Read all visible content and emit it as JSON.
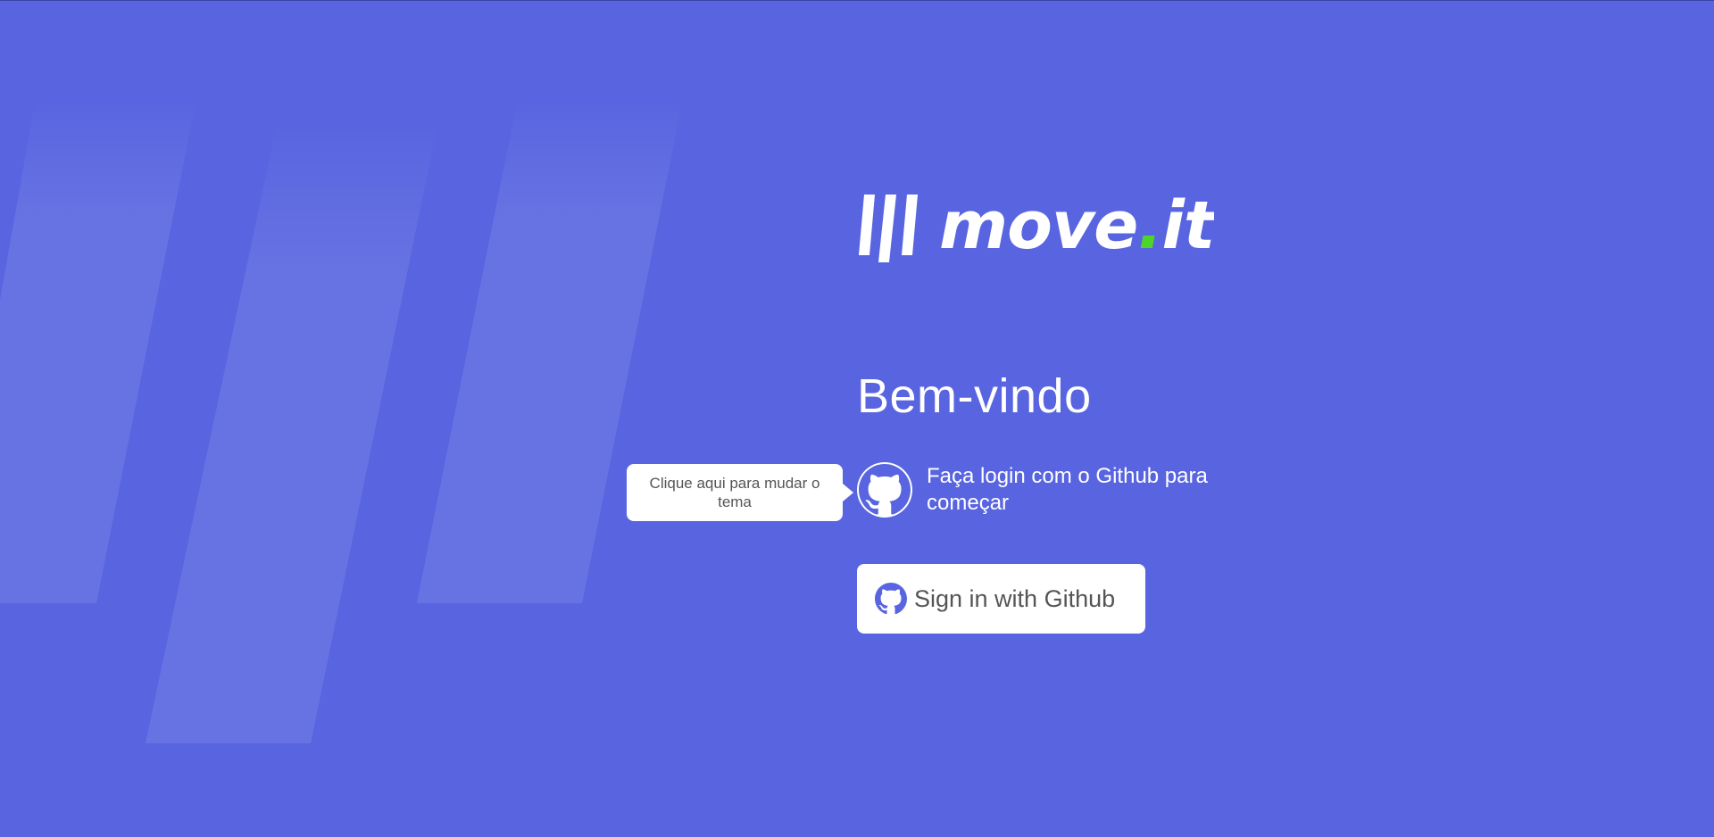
{
  "brand": {
    "name_main": "move",
    "name_dot": ".",
    "name_tld": "it"
  },
  "colors": {
    "background": "#5965e0",
    "accent_dot": "#4cd62b",
    "button_bg": "#ffffff",
    "button_text": "#555555"
  },
  "welcome": {
    "title": "Bem-vindo"
  },
  "login": {
    "text": "Faça login com o Github para começar",
    "icon": "github-icon"
  },
  "tooltip": {
    "text": "Clique aqui para mudar o tema"
  },
  "signin_button": {
    "label": "Sign in with Github",
    "icon": "github-icon"
  }
}
